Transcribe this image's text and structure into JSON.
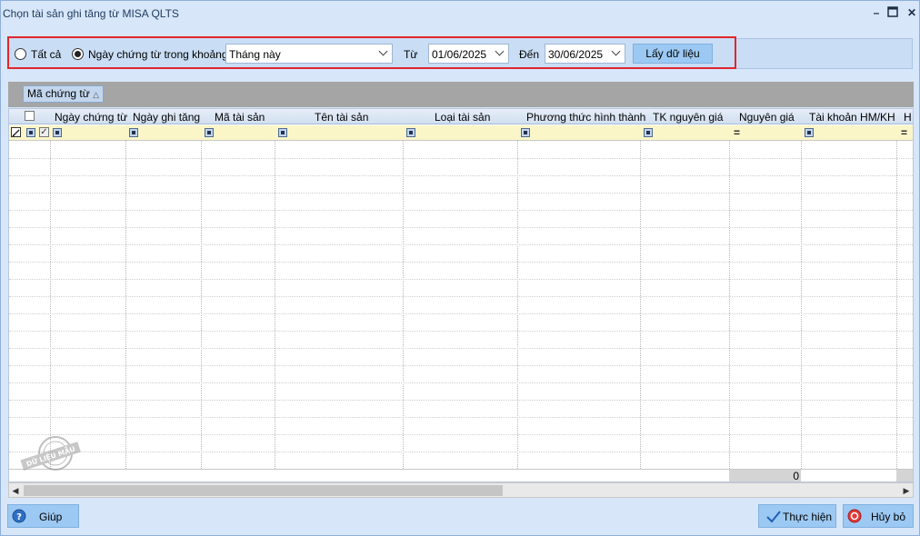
{
  "window": {
    "title": "Chọn tài sản ghi tăng từ MISA QLTS"
  },
  "filter": {
    "radio_all_label": "Tất cả",
    "radio_range_label": "Ngày chứng từ trong khoảng",
    "selected_radio": "range",
    "period_value": "Tháng này",
    "from_label": "Từ",
    "from_date": "01/06/2025",
    "to_label": "Đến",
    "to_date": "30/06/2025",
    "fetch_button_label": "Lấy dữ liệu"
  },
  "group": {
    "tag_label": "Mã chứng từ"
  },
  "grid": {
    "columns": [
      "Ngày chứng từ",
      "Ngày ghi tăng",
      "Mã tài sản",
      "Tên tài sản",
      "Loại tài sản",
      "Phương thức hình thành",
      "TK nguyên giá",
      "Nguyên giá",
      "Tài khoản HM/KH",
      "H"
    ],
    "total_value": "0"
  },
  "watermark": {
    "text": "DỮ LIỆU MẪU"
  },
  "buttons": {
    "help": "Giúp",
    "execute": "Thực hiện",
    "cancel": "Hủy bỏ"
  },
  "colors": {
    "accent_red": "#e0262e",
    "button_blue": "#9cc9f3",
    "window_bg": "#d7e6f8",
    "filter_row_bg": "#fbf6c8"
  }
}
